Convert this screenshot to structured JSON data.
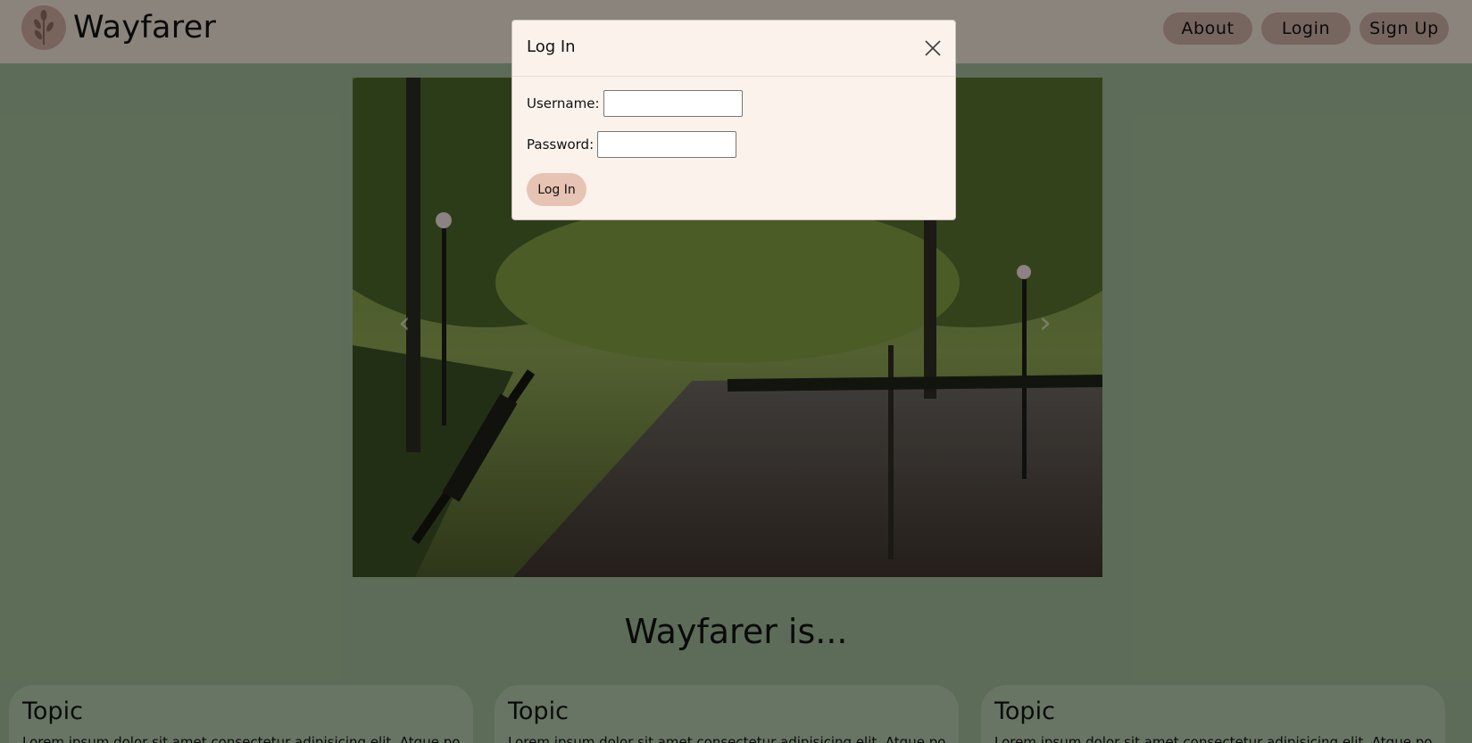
{
  "navbar": {
    "brand": "Wayfarer",
    "about_label": "About",
    "login_label": "Login",
    "signup_label": "Sign Up"
  },
  "carousel": {
    "prev_icon": "chevron-left-icon",
    "next_icon": "chevron-right-icon"
  },
  "section": {
    "title": "Wayfarer is..."
  },
  "cards": [
    {
      "title": "Topic",
      "text": "Lorem ipsum dolor sit amet consectetur adipisicing elit. Atque possimus"
    },
    {
      "title": "Topic",
      "text": "Lorem ipsum dolor sit amet consectetur adipisicing elit. Atque possimus"
    },
    {
      "title": "Topic",
      "text": "Lorem ipsum dolor sit amet consectetur adipisicing elit. Atque possimus"
    }
  ],
  "modal": {
    "title": "Log In",
    "username_label": "Username:",
    "username_value": "",
    "password_label": "Password:",
    "password_value": "",
    "submit_label": "Log In"
  },
  "colors": {
    "navbar_bg": "#e8dccf",
    "page_bg": "#9bb593",
    "button_bg": "#c7a99e",
    "modal_bg": "#fbf2ec",
    "modal_button_bg": "#e7c3b4"
  }
}
